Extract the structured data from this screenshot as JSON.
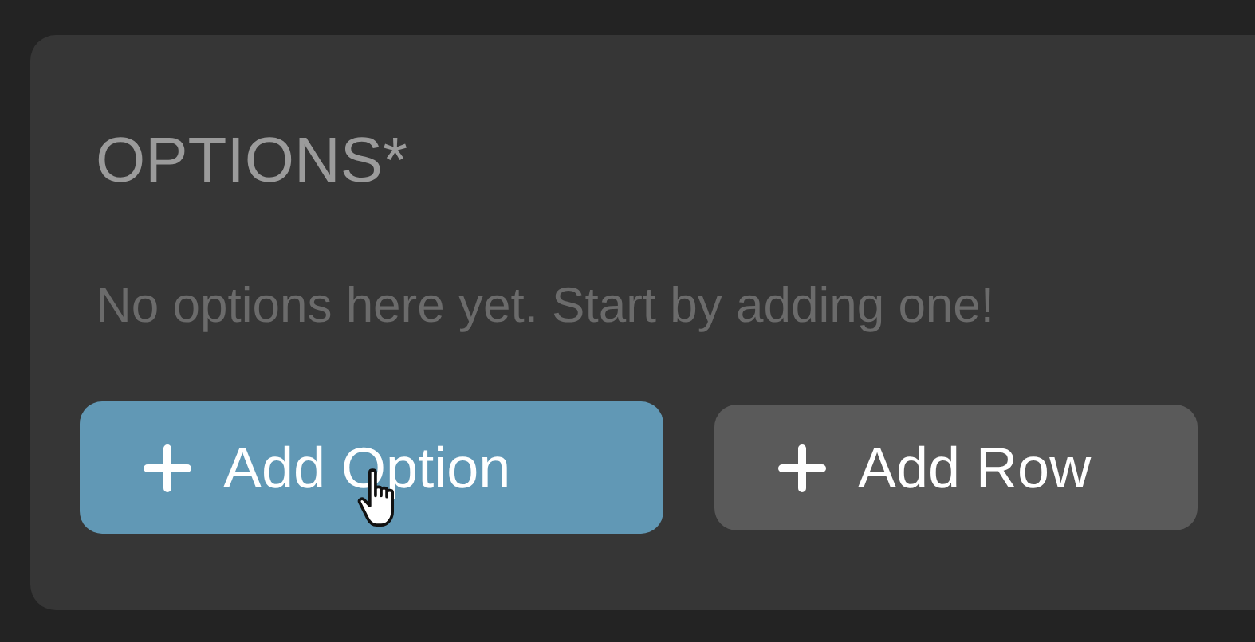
{
  "panel": {
    "title": "OPTIONS*",
    "empty_message": "No options here yet. Start by adding one!"
  },
  "buttons": [
    {
      "label": "Add Option",
      "kind": "primary",
      "hovered": true
    },
    {
      "label": "Add Row",
      "kind": "secondary",
      "hovered": false
    }
  ]
}
